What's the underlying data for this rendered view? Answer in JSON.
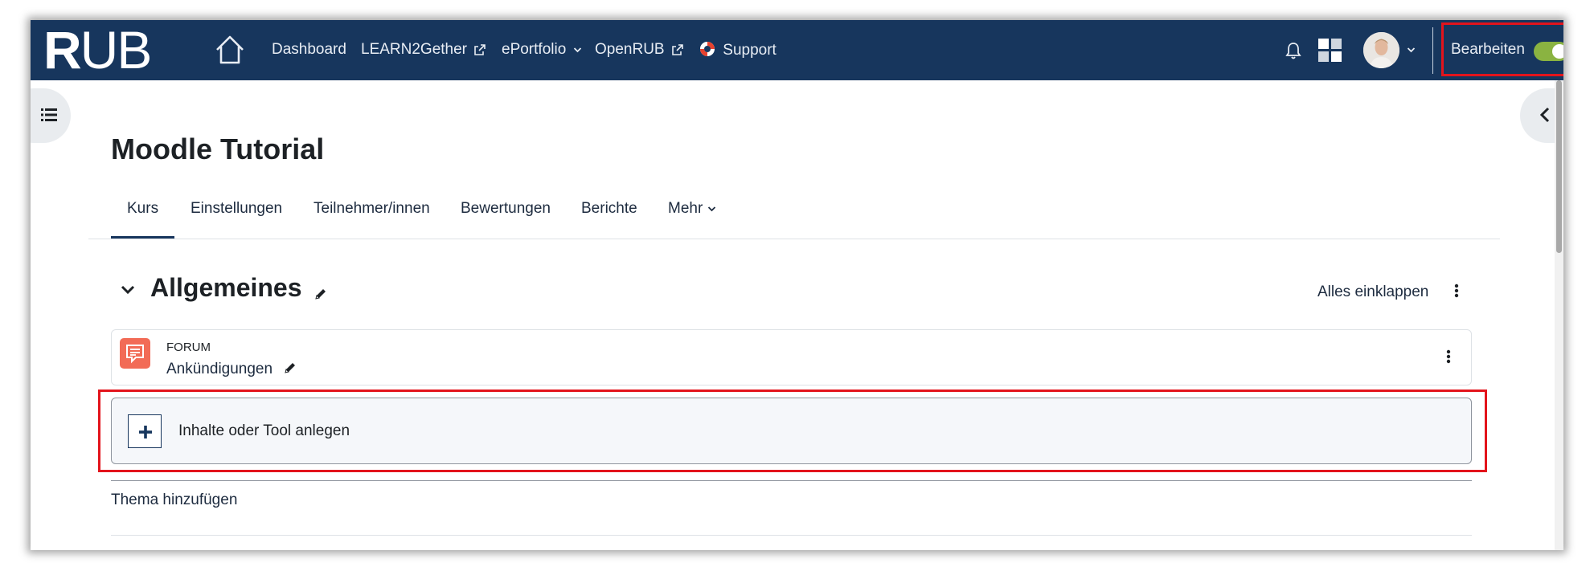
{
  "navbar": {
    "logo_text_a": "R",
    "logo_text_b": "U",
    "logo_text_c": "B",
    "links": [
      {
        "label": "Dashboard"
      },
      {
        "label": "LEARN2Gether"
      },
      {
        "label": "ePortfolio"
      },
      {
        "label": "OpenRUB"
      },
      {
        "label": "Support"
      }
    ],
    "edit_label": "Bearbeiten",
    "edit_mode_on": true,
    "colors": {
      "navbar_bg": "#17365d",
      "toggle_on": "#8ab341",
      "highlight": "#e3141c"
    }
  },
  "course": {
    "title": "Moodle Tutorial",
    "tabs": [
      {
        "label": "Kurs",
        "active": true
      },
      {
        "label": "Einstellungen"
      },
      {
        "label": "Teilnehmer/innen"
      },
      {
        "label": "Bewertungen"
      },
      {
        "label": "Berichte"
      },
      {
        "label": "Mehr"
      }
    ]
  },
  "section": {
    "title": "Allgemeines",
    "collapse_all": "Alles einklappen",
    "activity": {
      "type": "FORUM",
      "name": "Ankündigungen",
      "icon": "forum-icon",
      "icon_color": "#f26b56"
    },
    "add_content": "Inhalte oder Tool anlegen",
    "add_topic": "Thema hinzufügen"
  }
}
